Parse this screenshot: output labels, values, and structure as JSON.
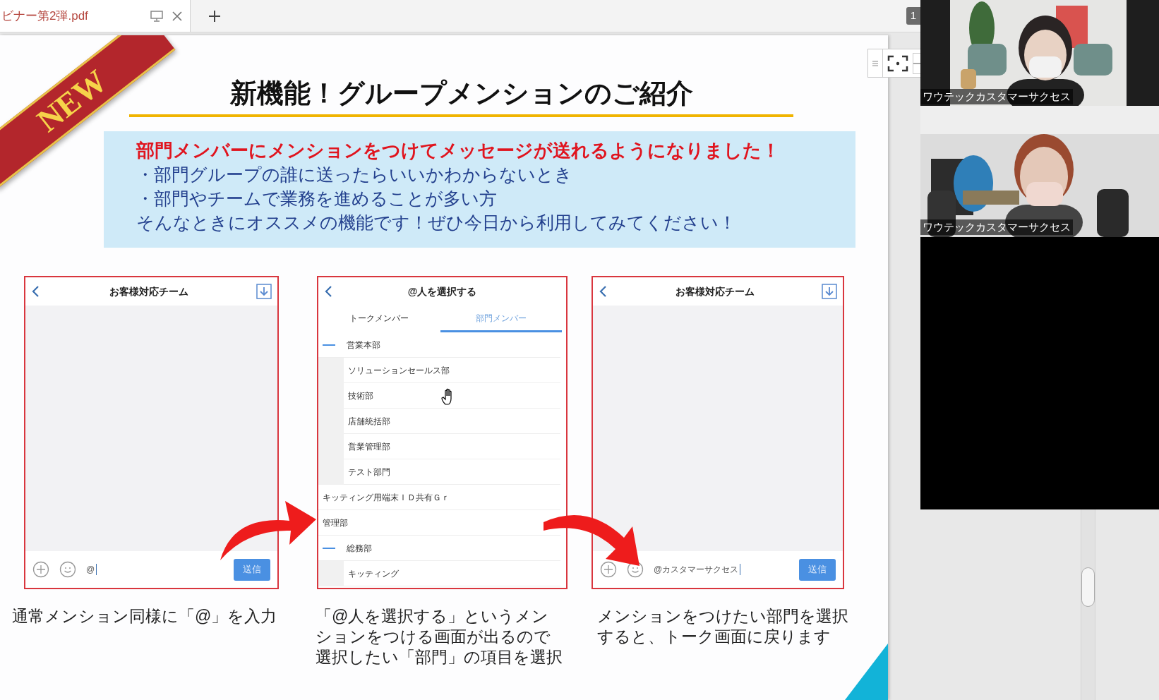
{
  "tab": {
    "title": "ビナー第2弾.pdf"
  },
  "page_badge": "1",
  "slide": {
    "badge": "NEW",
    "title": "新機能！グループメンションのご紹介",
    "callout": {
      "headline": "部門メンバーにメンションをつけてメッセージが送れるようになりました！",
      "lines": [
        "・部門グループの誰に送ったらいいかわからないとき",
        "・部門やチームで業務を進めることが多い方",
        "そんなときにオススメの機能です！ぜひ今日から利用してみてください！"
      ]
    },
    "phones": [
      {
        "kind": "chat",
        "header": "お客様対応チーム",
        "input": "@",
        "send": "送信"
      },
      {
        "kind": "picker",
        "header": "@人を選択する",
        "tabs": [
          {
            "label": "トークメンバー",
            "selected": false
          },
          {
            "label": "部門メンバー",
            "selected": true
          }
        ],
        "items": [
          {
            "label": "営業本部",
            "expanded": true,
            "children": [
              {
                "label": "ソリューションセールス部"
              },
              {
                "label": "技術部"
              },
              {
                "label": "店舗統括部"
              },
              {
                "label": "営業管理部"
              },
              {
                "label": "テスト部門"
              }
            ]
          },
          {
            "label": "キッティング用端末ＩＤ共有Ｇｒ",
            "expanded": false
          },
          {
            "label": "管理部",
            "expanded": false
          },
          {
            "label": "総務部",
            "expanded": true,
            "children": [
              {
                "label": "キッティング"
              }
            ]
          }
        ]
      },
      {
        "kind": "chat",
        "header": "お客様対応チーム",
        "input": "@カスタマーサクセス",
        "send": "送信"
      }
    ],
    "captions": [
      [
        "通常メンション同様に「@」を入力"
      ],
      [
        "「@人を選択する」というメン",
        "ションをつける画面が出るので",
        "選択したい「部門」の項目を選択"
      ],
      [
        "メンションをつけたい部門を選択",
        "すると、トーク画面に戻ります"
      ]
    ]
  },
  "participants": [
    {
      "name": "ワウテックカスタマーサクセス"
    },
    {
      "name": "ワウテックカスタマーサクセス"
    }
  ]
}
